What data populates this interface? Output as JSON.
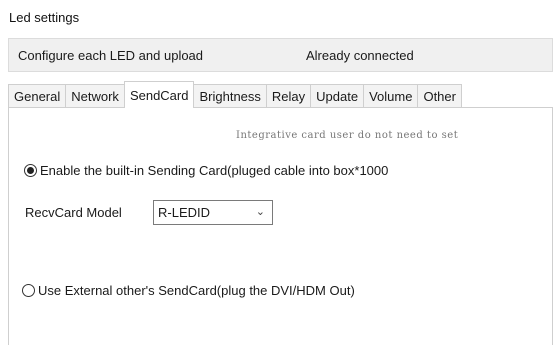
{
  "window": {
    "title": "Led settings"
  },
  "status": {
    "left_text": "Configure each LED and upload",
    "connection": "Already connected"
  },
  "tabs": [
    {
      "label": "General",
      "active": false
    },
    {
      "label": "Network",
      "active": false
    },
    {
      "label": "SendCard",
      "active": true
    },
    {
      "label": "Brightness",
      "active": false
    },
    {
      "label": "Relay",
      "active": false
    },
    {
      "label": "Update",
      "active": false
    },
    {
      "label": "Volume",
      "active": false
    },
    {
      "label": "Other",
      "active": false
    }
  ],
  "sendcard": {
    "hint": "Integrative card user do not need to set",
    "internal_option": {
      "label": "Enable the built-in Sending Card(pluged cable into box*1000",
      "selected": true
    },
    "recvcard_model": {
      "label": "RecvCard Model",
      "value": "R-LEDID",
      "chevron_icon": "chevron-down-icon"
    },
    "external_option": {
      "label": "Use External other's SendCard(plug the DVI/HDM Out)",
      "selected": false
    }
  }
}
